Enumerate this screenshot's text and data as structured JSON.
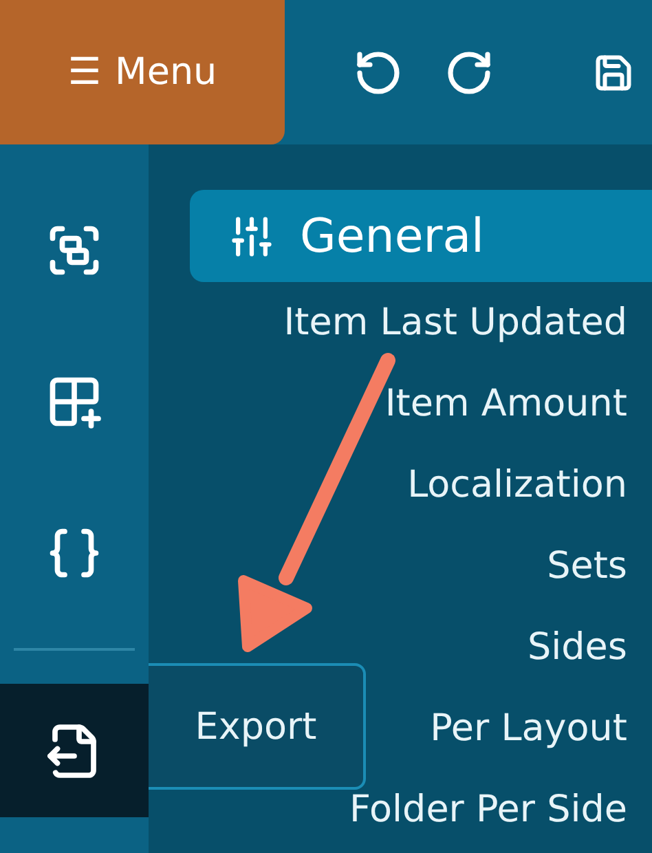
{
  "toolbar": {
    "menu_label": "Menu",
    "menu_icon": "☰"
  },
  "sidebar": {
    "items": [
      {
        "kind": "icon",
        "selected": false
      },
      {
        "kind": "icon",
        "selected": false
      },
      {
        "kind": "icon",
        "selected": false
      },
      {
        "kind": "divider"
      },
      {
        "kind": "icon",
        "selected": true,
        "tooltip": "Export"
      }
    ]
  },
  "panel": {
    "header": "General",
    "items": [
      "Item Last Updated",
      "Item Amount",
      "Localization",
      "Sets",
      "Sides",
      "Per Layout",
      "Folder Per Side"
    ]
  },
  "annotation": {
    "kind": "arrow"
  }
}
